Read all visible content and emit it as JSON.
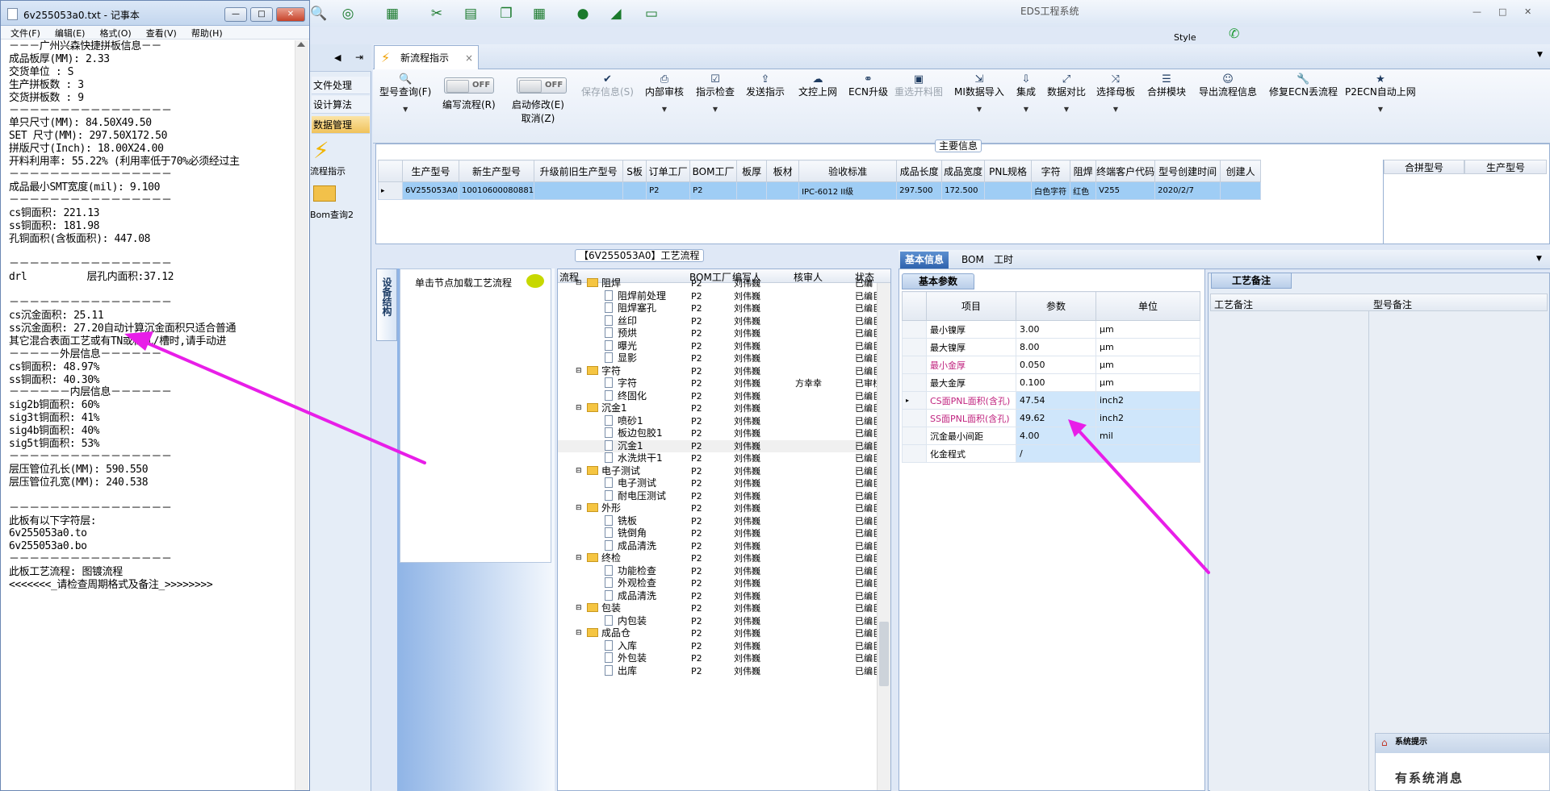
{
  "notepad": {
    "title": "6v255053a0.txt - 记事本",
    "menu": [
      "文件(F)",
      "编辑(E)",
      "格式(O)",
      "查看(V)",
      "帮助(H)"
    ],
    "text": "－－－广州兴森快捷拼板信息－－\n成品板厚(MM): 2.33\n交货单位 : S\n生产拼板数 : 3\n交货拼板数 : 9\n－－－－－－－－－－－－－－－－\n单只尺寸(MM): 84.50X49.50\nSET 尺寸(MM): 297.50X172.50\n拼版尺寸(Inch): 18.00X24.00\n开料利用率: 55.22% (利用率低于70%必须经过主\n－－－－－－－－－－－－－－－－\n成品最小SMT宽度(mil): 9.100\n－－－－－－－－－－－－－－－－\ncs铜面积: 221.13\nss铜面积: 181.98\n孔铜面积(含板面积): 447.08\n\n－－－－－－－－－－－－－－－－\ndrl          层孔内面积:37.12\n\n－－－－－－－－－－－－－－－－\ncs沉金面积: 25.11\nss沉金面积: 27.20自动计算沉金面积只适合普通\n其它混合表面工艺或有TN或梯孔/槽时,请手动进\n－－－－－外层信息－－－－－－\ncs铜面积: 48.97%\nss铜面积: 40.30%\n－－－－－－内层信息－－－－－－\nsig2b铜面积: 60%\nsig3t铜面积: 41%\nsig4b铜面积: 40%\nsig5t铜面积: 53%\n－－－－－－－－－－－－－－－－\n层压管位孔长(MM): 590.550\n层压管位孔宽(MM): 240.538\n\n－－－－－－－－－－－－－－－－\n此板有以下字符层:\n6v255053a0.to\n6v255053a0.bo\n－－－－－－－－－－－－－－－－\n此板工艺流程: 图镀流程\n<<<<<<<_请检查周期格式及备注_>>>>>>>>"
  },
  "app": {
    "title": "EDS工程系统",
    "style_label": "Style",
    "top_icons": [
      "search-icon",
      "lifebuoy-icon",
      "table-icon",
      "scissors-icon",
      "film-icon",
      "copy-icon",
      "grid-icon",
      "user-icon",
      "chart-icon",
      "monitor-icon"
    ]
  },
  "nav": {
    "items": [
      "文件处理",
      "设计算法",
      "数据管理"
    ],
    "flow_label": "流程指示",
    "bom_label": "Bom查询2"
  },
  "tab": {
    "label": "新流程指示"
  },
  "toolbar": {
    "buttons": [
      {
        "label": "型号查询(F)",
        "icon": "search-icon"
      },
      {
        "label": "编写流程(R)",
        "icon": "toggle"
      },
      {
        "label": "启动修改(E)",
        "sub": "取消(Z)",
        "icon": "toggle"
      },
      {
        "label": "保存信息(S)",
        "icon": "check-icon"
      },
      {
        "label": "内部审核",
        "icon": "print-icon"
      },
      {
        "label": "指示检查",
        "icon": "checkbox-icon"
      },
      {
        "label": "发送指示",
        "icon": "upload-icon"
      },
      {
        "label": "文控上网",
        "icon": "cloud-icon"
      },
      {
        "label": "ECN升级",
        "icon": "binoculars-icon"
      },
      {
        "label": "重选开料图",
        "icon": "image-icon"
      },
      {
        "label": "MI数据导入",
        "icon": "login-icon"
      },
      {
        "label": "集成",
        "icon": "download-icon"
      },
      {
        "label": "数据对比",
        "icon": "compare-icon"
      },
      {
        "label": "选择母板",
        "icon": "shuffle-icon"
      },
      {
        "label": "合拼模块",
        "icon": "list-icon"
      },
      {
        "label": "导出流程信息",
        "icon": "smile-icon"
      },
      {
        "label": "修复ECN丢流程",
        "icon": "wrench-icon"
      },
      {
        "label": "P2ECN自动上网",
        "icon": "star-icon"
      }
    ],
    "toggle_text": "OFF"
  },
  "main_info": {
    "legend": "主要信息",
    "columns": [
      "生产型号",
      "新生产型号",
      "升级前旧生产型号",
      "S板",
      "订单工厂",
      "BOM工厂",
      "板厚",
      "板材",
      "验收标准",
      "成品长度",
      "成品宽度",
      "PNL规格",
      "字符",
      "阻焊",
      "终端客户代码",
      "型号创建时间",
      "创建人"
    ],
    "row": [
      "6V255053A0",
      "10010600080881",
      "",
      "",
      "P2",
      "P2",
      "",
      "",
      "IPC-6012 II级",
      "297.500",
      "172.500",
      "",
      "白色字符",
      "红色",
      "V255",
      "2020/2/7",
      ""
    ],
    "merge_cols": [
      "合拼型号",
      "生产型号"
    ]
  },
  "process": {
    "header": "【6V255053A0】工艺流程",
    "side_tab": "设备结构",
    "side_hint": "单击节点加载工艺流程",
    "columns": [
      "流程",
      "BOM工厂",
      "编写人",
      "核审人",
      "状态"
    ],
    "rows": [
      {
        "name": "阻焊",
        "level": 0,
        "bom": "P2",
        "writer": "刘伟巍",
        "reviewer": "",
        "status": "已编"
      },
      {
        "name": "阻焊前处理",
        "level": 1,
        "bom": "P2",
        "writer": "刘伟巍",
        "reviewer": "",
        "status": "已编巨"
      },
      {
        "name": "阻焊塞孔",
        "level": 1,
        "bom": "P2",
        "writer": "刘伟巍",
        "reviewer": "",
        "status": "已编巨"
      },
      {
        "name": "丝印",
        "level": 1,
        "bom": "P2",
        "writer": "刘伟巍",
        "reviewer": "",
        "status": "已编巨"
      },
      {
        "name": "预烘",
        "level": 1,
        "bom": "P2",
        "writer": "刘伟巍",
        "reviewer": "",
        "status": "已编巨"
      },
      {
        "name": "曝光",
        "level": 1,
        "bom": "P2",
        "writer": "刘伟巍",
        "reviewer": "",
        "status": "已编巨"
      },
      {
        "name": "显影",
        "level": 1,
        "bom": "P2",
        "writer": "刘伟巍",
        "reviewer": "",
        "status": "已编巨"
      },
      {
        "name": "字符",
        "level": 0,
        "bom": "P2",
        "writer": "刘伟巍",
        "reviewer": "",
        "status": "已编巨"
      },
      {
        "name": "字符",
        "level": 1,
        "bom": "P2",
        "writer": "刘伟巍",
        "reviewer": "方幸幸",
        "status": "已审柱"
      },
      {
        "name": "终固化",
        "level": 1,
        "bom": "P2",
        "writer": "刘伟巍",
        "reviewer": "",
        "status": "已编巨"
      },
      {
        "name": "沉金1",
        "level": 0,
        "bom": "P2",
        "writer": "刘伟巍",
        "reviewer": "",
        "status": "已编巨"
      },
      {
        "name": "喷砂1",
        "level": 1,
        "bom": "P2",
        "writer": "刘伟巍",
        "reviewer": "",
        "status": "已编巨"
      },
      {
        "name": "板边包胶1",
        "level": 1,
        "bom": "P2",
        "writer": "刘伟巍",
        "reviewer": "",
        "status": "已编巨"
      },
      {
        "name": "沉金1",
        "level": 1,
        "bom": "P2",
        "writer": "刘伟巍",
        "reviewer": "",
        "status": "已编巨",
        "hl": true
      },
      {
        "name": "水洗烘干1",
        "level": 1,
        "bom": "P2",
        "writer": "刘伟巍",
        "reviewer": "",
        "status": "已编巨"
      },
      {
        "name": "电子测试",
        "level": 0,
        "bom": "P2",
        "writer": "刘伟巍",
        "reviewer": "",
        "status": "已编巨"
      },
      {
        "name": "电子测试",
        "level": 1,
        "bom": "P2",
        "writer": "刘伟巍",
        "reviewer": "",
        "status": "已编巨"
      },
      {
        "name": "耐电压测试",
        "level": 1,
        "bom": "P2",
        "writer": "刘伟巍",
        "reviewer": "",
        "status": "已编巨"
      },
      {
        "name": "外形",
        "level": 0,
        "bom": "P2",
        "writer": "刘伟巍",
        "reviewer": "",
        "status": "已编巨"
      },
      {
        "name": "铣板",
        "level": 1,
        "bom": "P2",
        "writer": "刘伟巍",
        "reviewer": "",
        "status": "已编巨"
      },
      {
        "name": "铣倒角",
        "level": 1,
        "bom": "P2",
        "writer": "刘伟巍",
        "reviewer": "",
        "status": "已编巨"
      },
      {
        "name": "成品清洗",
        "level": 1,
        "bom": "P2",
        "writer": "刘伟巍",
        "reviewer": "",
        "status": "已编巨"
      },
      {
        "name": "终检",
        "level": 0,
        "bom": "P2",
        "writer": "刘伟巍",
        "reviewer": "",
        "status": "已编巨"
      },
      {
        "name": "功能检查",
        "level": 1,
        "bom": "P2",
        "writer": "刘伟巍",
        "reviewer": "",
        "status": "已编巨"
      },
      {
        "name": "外观检查",
        "level": 1,
        "bom": "P2",
        "writer": "刘伟巍",
        "reviewer": "",
        "status": "已编巨"
      },
      {
        "name": "成品清洗",
        "level": 1,
        "bom": "P2",
        "writer": "刘伟巍",
        "reviewer": "",
        "status": "已编巨"
      },
      {
        "name": "包装",
        "level": 0,
        "bom": "P2",
        "writer": "刘伟巍",
        "reviewer": "",
        "status": "已编巨"
      },
      {
        "name": "内包装",
        "level": 1,
        "bom": "P2",
        "writer": "刘伟巍",
        "reviewer": "",
        "status": "已编巨"
      },
      {
        "name": "成品仓",
        "level": 0,
        "bom": "P2",
        "writer": "刘伟巍",
        "reviewer": "",
        "status": "已编巨"
      },
      {
        "name": "入库",
        "level": 1,
        "bom": "P2",
        "writer": "刘伟巍",
        "reviewer": "",
        "status": "已编巨"
      },
      {
        "name": "外包装",
        "level": 1,
        "bom": "P2",
        "writer": "刘伟巍",
        "reviewer": "",
        "status": "已编巨"
      },
      {
        "name": "出库",
        "level": 1,
        "bom": "P2",
        "writer": "刘伟巍",
        "reviewer": "",
        "status": "已编巨"
      }
    ]
  },
  "basic": {
    "tabs": [
      "基本信息",
      "BOM",
      "工时"
    ],
    "sub_tab": "基本参数",
    "columns": [
      "项目",
      "参数",
      "单位"
    ],
    "rows": [
      {
        "item": "最小镍厚",
        "value": "3.00",
        "unit": "μm",
        "pink": false
      },
      {
        "item": "最大镍厚",
        "value": "8.00",
        "unit": "μm",
        "pink": false
      },
      {
        "item": "最小金厚",
        "value": "0.050",
        "unit": "μm",
        "pink": true
      },
      {
        "item": "最大金厚",
        "value": "0.100",
        "unit": "μm",
        "pink": false
      },
      {
        "item": "CS面PNL面积(含孔)",
        "value": "47.54",
        "unit": "inch2",
        "pink": true,
        "sel": true
      },
      {
        "item": "SS面PNL面积(含孔)",
        "value": "49.62",
        "unit": "inch2",
        "pink": true,
        "sel": true
      },
      {
        "item": "沉金最小间距",
        "value": "4.00",
        "unit": "mil",
        "pink": false,
        "sel": true
      },
      {
        "item": "化金程式",
        "value": "/",
        "unit": "",
        "pink": false,
        "sel": true
      }
    ]
  },
  "remark": {
    "tab": "工艺备注",
    "columns": [
      "工艺备注",
      "型号备注"
    ]
  },
  "system_msg": {
    "title": "系统提示",
    "body": "有系统消息"
  },
  "colors": {
    "arrow": "#e81ee8",
    "selected_row": "#9fcdf5",
    "accent": "#2f63ad"
  }
}
